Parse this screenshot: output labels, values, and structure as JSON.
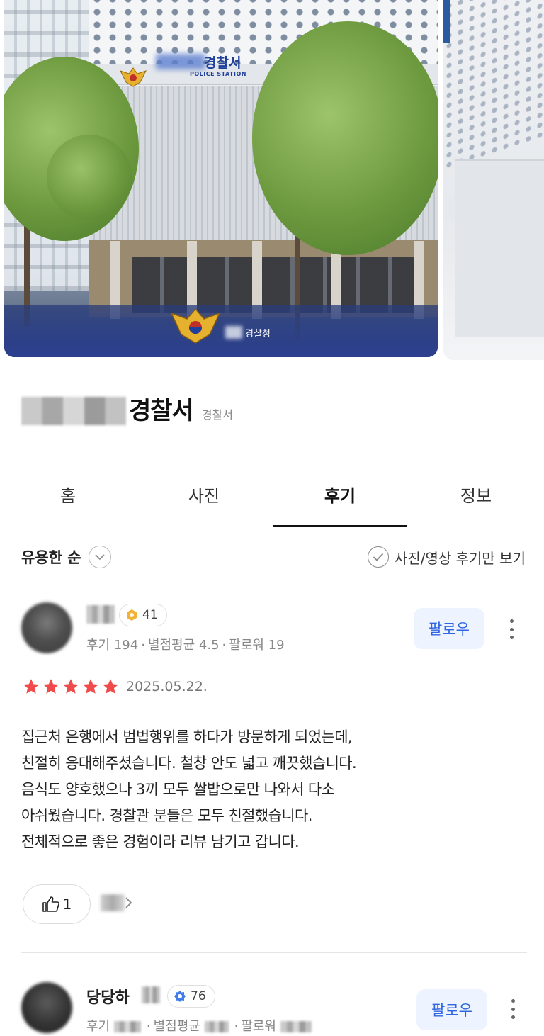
{
  "photos": {
    "caption": "경찰청",
    "sign_text": "경찰서",
    "sign_subtext": "POLICE STATION"
  },
  "place": {
    "name": "경찰서",
    "category": "경찰서"
  },
  "tabs": [
    {
      "label": "홈",
      "active": false
    },
    {
      "label": "사진",
      "active": false
    },
    {
      "label": "후기",
      "active": true
    },
    {
      "label": "정보",
      "active": false
    }
  ],
  "sort": {
    "label": "유용한 순",
    "photo_filter_label": "사진/영상 후기만 보기"
  },
  "reviews": [
    {
      "nickname": "",
      "badge_level": "41",
      "meta": {
        "reviews": "후기 194",
        "avg_rating": "별점평균 4.5",
        "followers": "팔로워 19"
      },
      "follow_label": "팔로우",
      "rating": 5,
      "date": "2025.05.22.",
      "body_lines": [
        "집근처 은행에서 범법행위를 하다가 방문하게 되었는데,",
        "친절히 응대해주셨습니다. 철창 안도 넓고 깨끗했습니다.",
        "음식도 양호했으나 3끼 모두 쌀밥으로만 나와서 다소",
        "아쉬웠습니다. 경찰관 분들은 모두 친절했습니다.",
        "전체적으로 좋은 경험이라 리뷰 남기고 갑니다."
      ],
      "likes": "1"
    },
    {
      "nickname": "당당하",
      "badge_level": "76",
      "meta": {
        "reviews": "후기",
        "avg_rating": "별점평균",
        "followers": "팔로워"
      },
      "follow_label": "팔로우"
    }
  ],
  "colors": {
    "star": "#f04a4a",
    "follow_text": "#2f66e0",
    "follow_bg": "#eef4ff",
    "badge_gold": "#f0b23a",
    "badge_blue": "#3f7ee8"
  },
  "icons": {
    "sort_chevron": "chevron-down-icon",
    "photo_filter": "check-circle-icon",
    "more": "more-vertical-icon",
    "like": "thumbs-up-icon",
    "reactions_more": "chevron-right-icon"
  }
}
